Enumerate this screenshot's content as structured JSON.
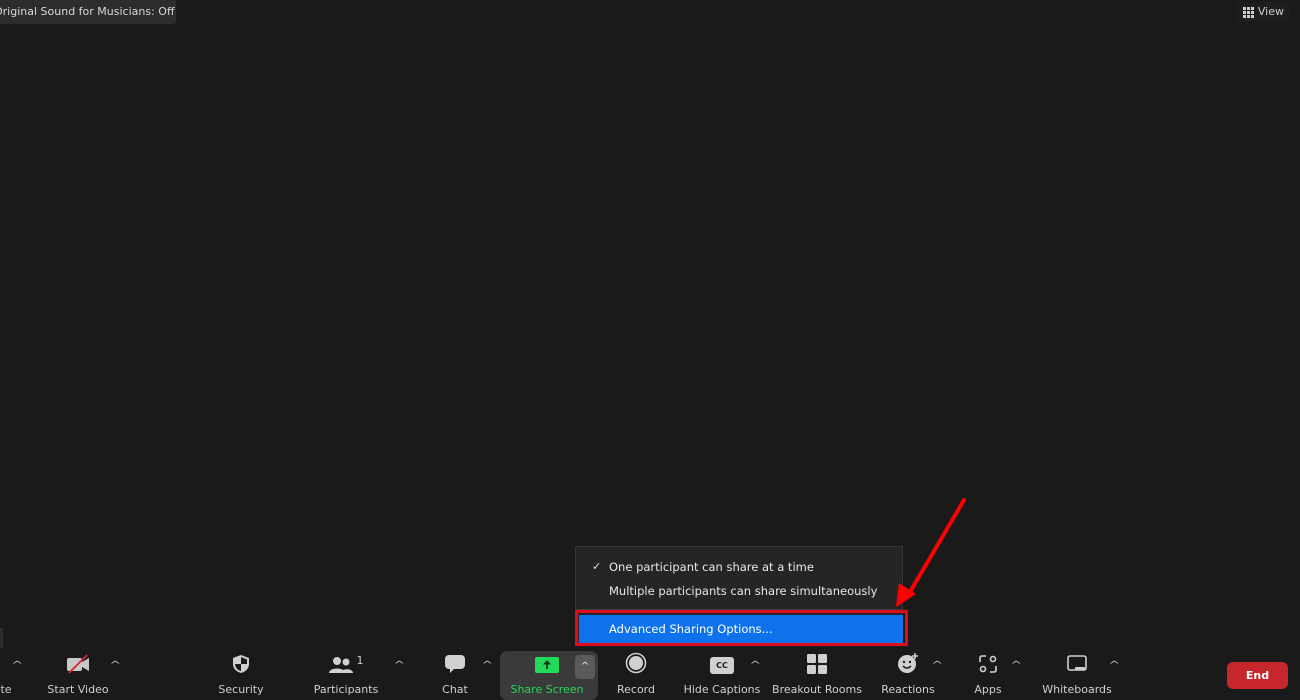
{
  "banner": {
    "text": "Original Sound for Musicians: Off"
  },
  "view_button": {
    "label": "View",
    "icon": "grid-icon"
  },
  "share_menu": {
    "items": [
      {
        "label": "One participant can share at a time",
        "checked": true
      },
      {
        "label": "Multiple participants can share simultaneously",
        "checked": false
      }
    ],
    "advanced": {
      "label": "Advanced Sharing Options...",
      "highlighted": true
    },
    "check_glyph": "✓"
  },
  "toolbar": {
    "mute_partial": "te",
    "start_video": "Start Video",
    "security": "Security",
    "participants": "Participants",
    "participants_count": "1",
    "chat": "Chat",
    "share_screen": "Share Screen",
    "record": "Record",
    "hide_captions": "Hide Captions",
    "cc_text": "CC",
    "breakout_rooms": "Breakout Rooms",
    "reactions": "Reactions",
    "apps": "Apps",
    "whiteboards": "Whiteboards",
    "end": "End",
    "caret": "^"
  },
  "colors": {
    "background": "#1a1a1a",
    "menu_highlight": "#0e72ed",
    "annotation_red": "#e00b1c",
    "share_green": "#23d959",
    "end_red": "#c7262c"
  }
}
